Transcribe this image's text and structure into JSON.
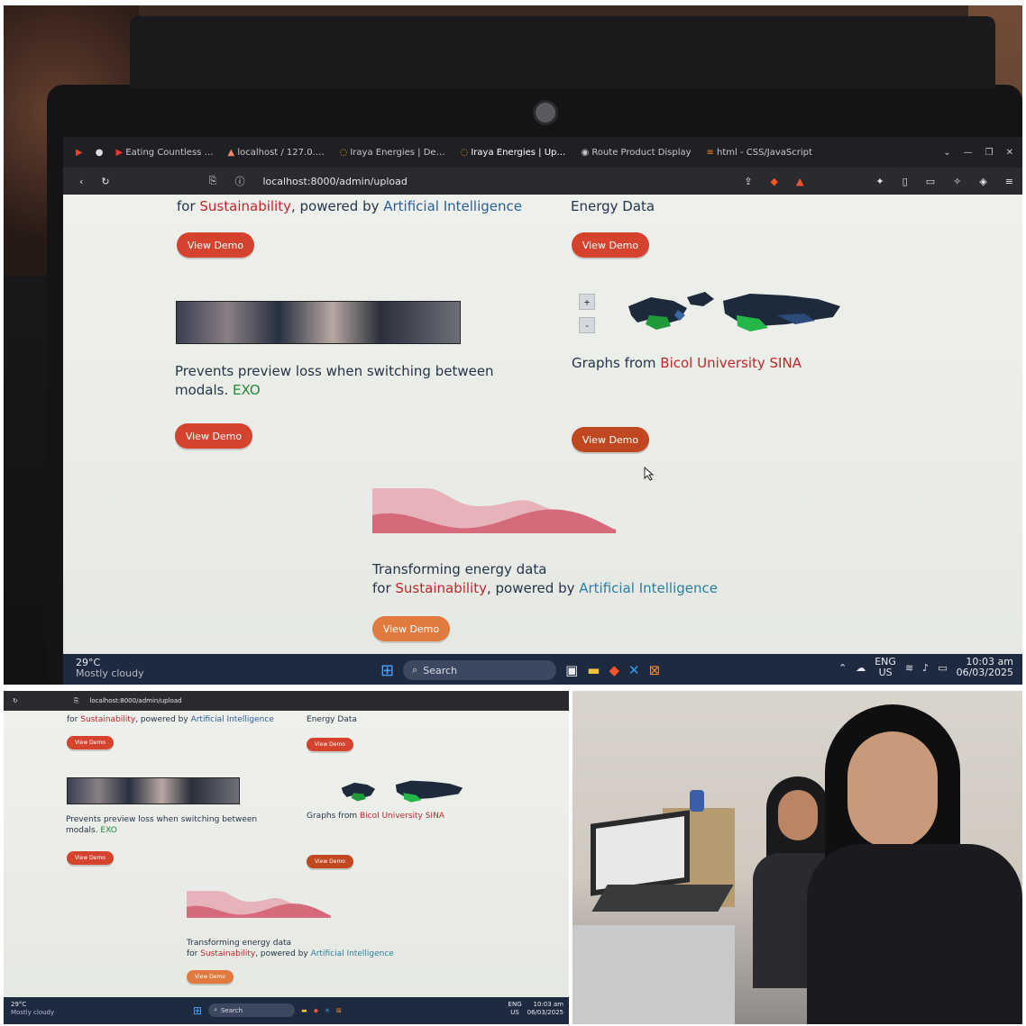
{
  "browser": {
    "tabs": [
      {
        "label": "Eating Countless Con",
        "active": false
      },
      {
        "label": "localhost / 127.0.0.1 /",
        "active": false
      },
      {
        "label": "Iraya Energies | Demo",
        "active": false
      },
      {
        "label": "Iraya Energies | Up",
        "active": true
      },
      {
        "label": "Route Product Display",
        "active": false
      },
      {
        "label": "html - CSS/JavaScript",
        "active": false
      }
    ],
    "url": "localhost:8000/admin/upload"
  },
  "page": {
    "card1": {
      "line_prefix": "for ",
      "highlight1": "Sustainability",
      "middle": ", powered by ",
      "highlight2": "Artificial Intelligence",
      "button": "View Demo"
    },
    "card2": {
      "line": "Energy Data",
      "button": "View Demo"
    },
    "card3": {
      "line1": "Prevents preview loss when switching between",
      "line2_prefix": "modals. ",
      "line2_highlight": "EXO",
      "button": "View Demo"
    },
    "card4": {
      "line_prefix": "Graphs from ",
      "line_highlight": "Bicol University SINA",
      "button": "View Demo",
      "zoom_in": "+",
      "zoom_out": "-"
    },
    "card5": {
      "line1": "Transforming energy data",
      "line2_prefix": "for ",
      "line2_h1": "Sustainability",
      "line2_mid": ", powered by ",
      "line2_h2": "Artificial Intelligence",
      "button": "View Demo"
    }
  },
  "taskbar": {
    "weather_temp": "29°C",
    "weather_desc": "Mostly cloudy",
    "search": "Search",
    "lang_top": "ENG",
    "lang_bottom": "US",
    "time": "10:03 am",
    "date": "06/03/2025"
  },
  "colors": {
    "accent_red": "#c0262c",
    "accent_green": "#1f8a3a",
    "accent_blue": "#2c5f9a",
    "button": "#d5432e"
  }
}
